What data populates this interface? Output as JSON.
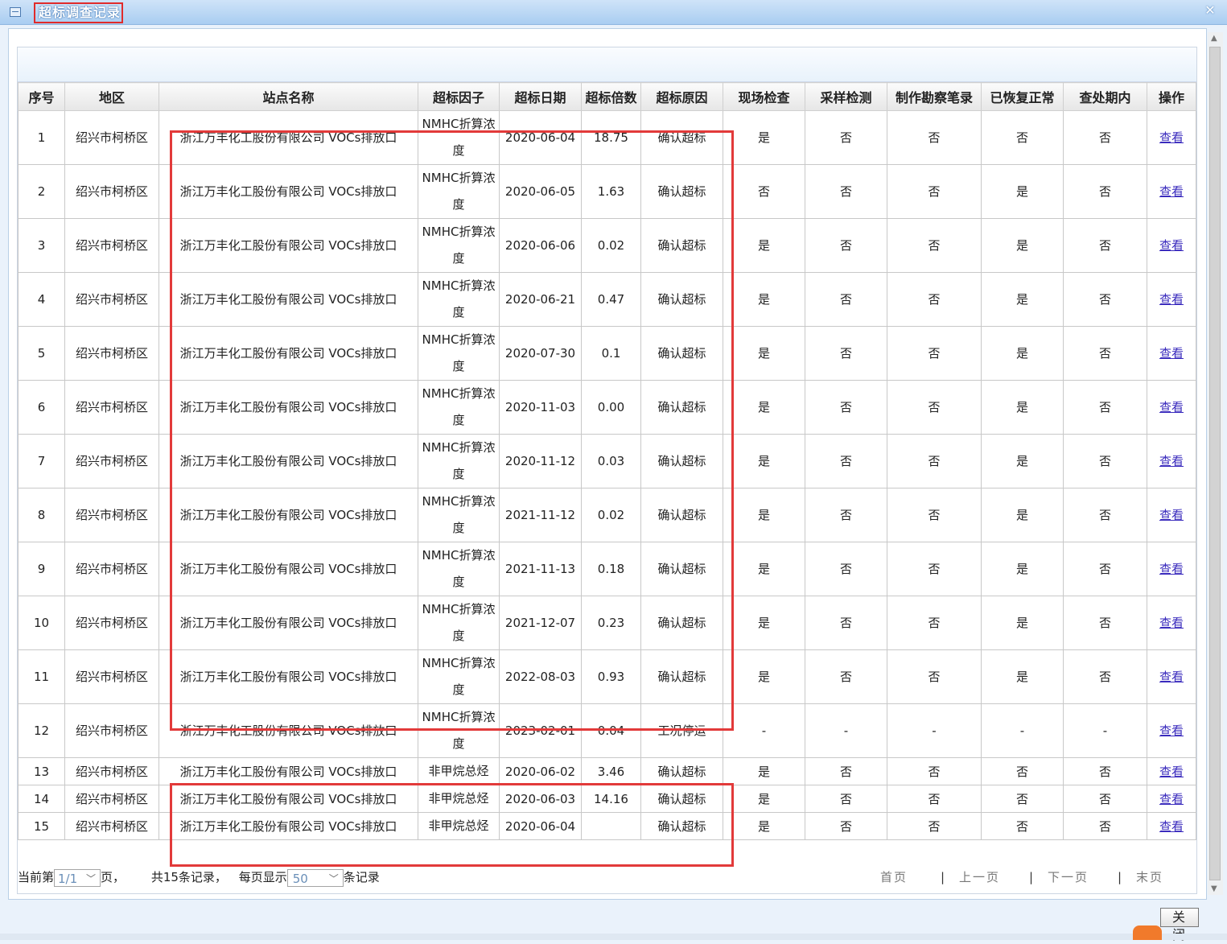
{
  "window": {
    "title": "超标调查记录",
    "close_symbol": "✕",
    "close_button": "关 闭"
  },
  "table": {
    "headers": [
      "序号",
      "地区",
      "站点名称",
      "超标因子",
      "超标日期",
      "超标倍数",
      "超标原因",
      "现场检查",
      "采样检测",
      "制作勘察笔录",
      "已恢复正常",
      "查处期内",
      "操作"
    ],
    "rows": [
      [
        "1",
        "绍兴市柯桥区",
        "浙江万丰化工股份有限公司 VOCs排放口",
        "NMHC折算浓度",
        "2020-06-04",
        "18.75",
        "确认超标",
        "是",
        "否",
        "否",
        "否",
        "否",
        "查看"
      ],
      [
        "2",
        "绍兴市柯桥区",
        "浙江万丰化工股份有限公司 VOCs排放口",
        "NMHC折算浓度",
        "2020-06-05",
        "1.63",
        "确认超标",
        "否",
        "否",
        "否",
        "是",
        "否",
        "查看"
      ],
      [
        "3",
        "绍兴市柯桥区",
        "浙江万丰化工股份有限公司 VOCs排放口",
        "NMHC折算浓度",
        "2020-06-06",
        "0.02",
        "确认超标",
        "是",
        "否",
        "否",
        "是",
        "否",
        "查看"
      ],
      [
        "4",
        "绍兴市柯桥区",
        "浙江万丰化工股份有限公司 VOCs排放口",
        "NMHC折算浓度",
        "2020-06-21",
        "0.47",
        "确认超标",
        "是",
        "否",
        "否",
        "是",
        "否",
        "查看"
      ],
      [
        "5",
        "绍兴市柯桥区",
        "浙江万丰化工股份有限公司 VOCs排放口",
        "NMHC折算浓度",
        "2020-07-30",
        "0.1",
        "确认超标",
        "是",
        "否",
        "否",
        "是",
        "否",
        "查看"
      ],
      [
        "6",
        "绍兴市柯桥区",
        "浙江万丰化工股份有限公司 VOCs排放口",
        "NMHC折算浓度",
        "2020-11-03",
        "0.00",
        "确认超标",
        "是",
        "否",
        "否",
        "是",
        "否",
        "查看"
      ],
      [
        "7",
        "绍兴市柯桥区",
        "浙江万丰化工股份有限公司 VOCs排放口",
        "NMHC折算浓度",
        "2020-11-12",
        "0.03",
        "确认超标",
        "是",
        "否",
        "否",
        "是",
        "否",
        "查看"
      ],
      [
        "8",
        "绍兴市柯桥区",
        "浙江万丰化工股份有限公司 VOCs排放口",
        "NMHC折算浓度",
        "2021-11-12",
        "0.02",
        "确认超标",
        "是",
        "否",
        "否",
        "是",
        "否",
        "查看"
      ],
      [
        "9",
        "绍兴市柯桥区",
        "浙江万丰化工股份有限公司 VOCs排放口",
        "NMHC折算浓度",
        "2021-11-13",
        "0.18",
        "确认超标",
        "是",
        "否",
        "否",
        "是",
        "否",
        "查看"
      ],
      [
        "10",
        "绍兴市柯桥区",
        "浙江万丰化工股份有限公司 VOCs排放口",
        "NMHC折算浓度",
        "2021-12-07",
        "0.23",
        "确认超标",
        "是",
        "否",
        "否",
        "是",
        "否",
        "查看"
      ],
      [
        "11",
        "绍兴市柯桥区",
        "浙江万丰化工股份有限公司 VOCs排放口",
        "NMHC折算浓度",
        "2022-08-03",
        "0.93",
        "确认超标",
        "是",
        "否",
        "否",
        "是",
        "否",
        "查看"
      ],
      [
        "12",
        "绍兴市柯桥区",
        "浙江万丰化工股份有限公司 VOCs排放口",
        "NMHC折算浓度",
        "2023-02-01",
        "0.04",
        "工况停运",
        "-",
        "-",
        "-",
        "-",
        "-",
        "查看"
      ],
      [
        "13",
        "绍兴市柯桥区",
        "浙江万丰化工股份有限公司 VOCs排放口",
        "非甲烷总烃",
        "2020-06-02",
        "3.46",
        "确认超标",
        "是",
        "否",
        "否",
        "否",
        "否",
        "查看"
      ],
      [
        "14",
        "绍兴市柯桥区",
        "浙江万丰化工股份有限公司 VOCs排放口",
        "非甲烷总烃",
        "2020-06-03",
        "14.16",
        "确认超标",
        "是",
        "否",
        "否",
        "否",
        "否",
        "查看"
      ],
      [
        "15",
        "绍兴市柯桥区",
        "浙江万丰化工股份有限公司 VOCs排放口",
        "非甲烷总烃",
        "2020-06-04",
        "",
        "确认超标",
        "是",
        "否",
        "否",
        "否",
        "否",
        "查看"
      ]
    ]
  },
  "pager": {
    "prefix": "当前第",
    "page_value": "1/1",
    "page_suffix": "页，",
    "total": "共15条记录，",
    "per_page_label": "每页显示",
    "per_page_value": "50",
    "per_page_suffix": "条记录",
    "first": "首页",
    "prev": "上一页",
    "next": "下一页",
    "last": "末页",
    "separator": "|"
  },
  "colors": {
    "highlight_border": "#e23a3a",
    "link": "#3a2bbd"
  }
}
